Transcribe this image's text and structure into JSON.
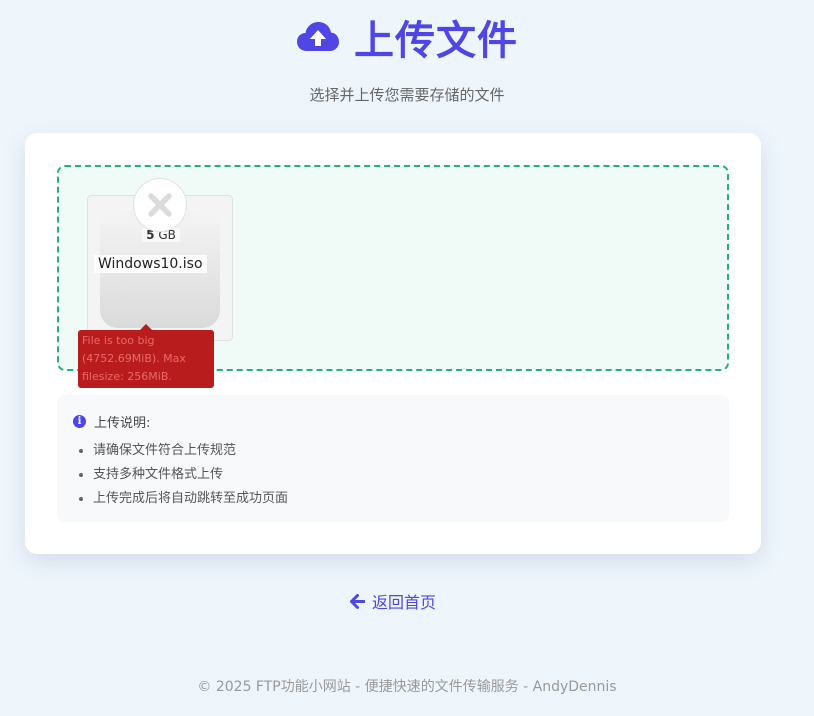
{
  "header": {
    "title": "上传文件",
    "subtitle": "选择并上传您需要存储的文件",
    "icon": "cloud-upload-icon"
  },
  "upload": {
    "file": {
      "size_value": "5",
      "size_unit": "GB",
      "name": "Windows10.iso",
      "status_icon": "error-x-icon",
      "error_message": "File is too big (4752.69MiB). Max filesize: 256MiB."
    }
  },
  "notes": {
    "title": "上传说明:",
    "icon": "info-icon",
    "items": [
      "请确保文件符合上传规范",
      "支持多种文件格式上传",
      "上传完成后将自动跳转至成功页面"
    ]
  },
  "back_link": {
    "label": "返回首页",
    "icon": "arrow-left-icon"
  },
  "footer": {
    "text": "© 2025 FTP功能小网站 - 便捷快速的文件传输服务 - AndyDennis"
  },
  "colors": {
    "accent": "#4f46e5",
    "dropzone_border": "#22b07d",
    "error": "#b91c1c"
  }
}
